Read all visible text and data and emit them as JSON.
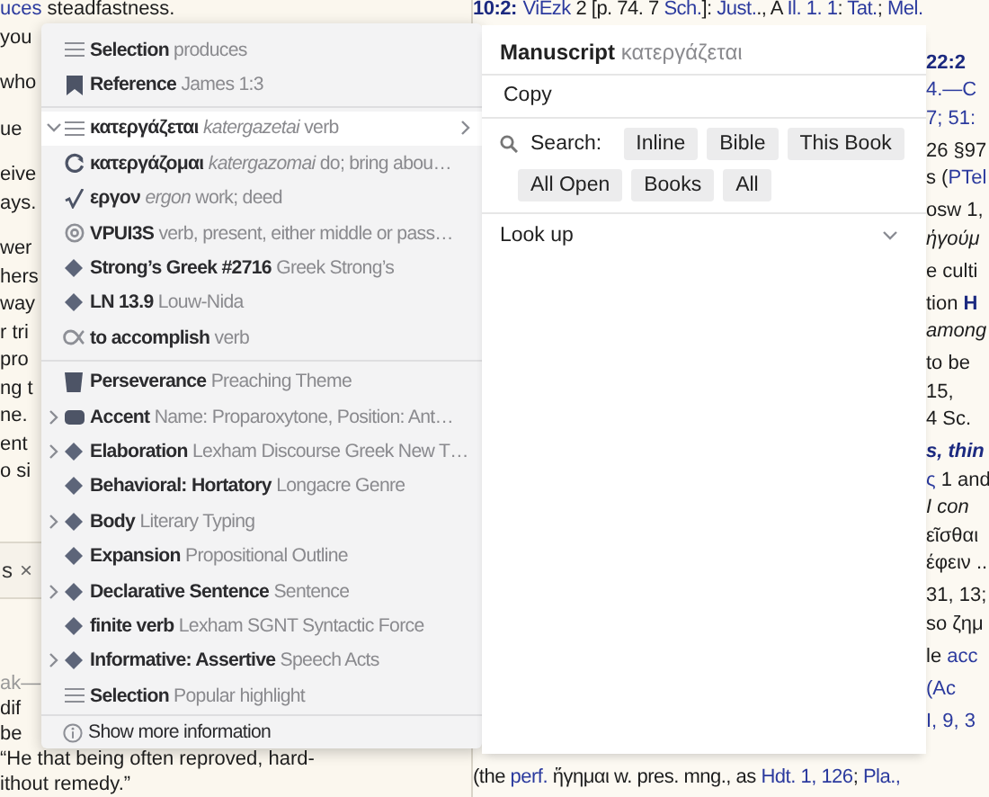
{
  "left_pane": {
    "paragraphs": [
      {
        "lines": [
          [
            {
              "text": "uces",
              "kind": "link"
            },
            {
              "text": " steadfastness."
            }
          ],
          [
            {
              "text": "you"
            }
          ]
        ]
      },
      {
        "lines": [
          [
            {
              "text": "who"
            }
          ]
        ]
      },
      {
        "lines": [
          [
            {
              "text": "ue"
            }
          ]
        ]
      },
      {
        "lines": [
          [
            {
              "text": "eive"
            }
          ],
          [
            {
              "text": "ays."
            }
          ]
        ]
      },
      {
        "lines": [
          [
            {
              "text": "wer"
            }
          ],
          [
            {
              "text": "hers"
            }
          ],
          [
            {
              "text": "way"
            }
          ],
          [
            {
              "text": "r tri"
            }
          ],
          [
            {
              "text": "pro"
            }
          ],
          [
            {
              "text": "ng t"
            }
          ],
          [
            {
              "text": "ne."
            }
          ],
          [
            {
              "text": "ent"
            }
          ],
          [
            {
              "text": "o si"
            }
          ]
        ]
      }
    ],
    "tab": {
      "label": "s",
      "close": "×"
    },
    "second_doc": {
      "header": "ak—",
      "lines": [
        [
          {
            "text": "dif"
          }
        ],
        [
          {
            "text": "be"
          }
        ],
        [
          {
            "text": "“He that being often reproved, hard-"
          }
        ],
        [
          {
            "text": "ithout remedy.”"
          }
        ]
      ]
    }
  },
  "right_pane": {
    "top_line": [
      {
        "text": "10:2:",
        "kind": "bold"
      },
      {
        "text": "ViEzk",
        "kind": "link"
      },
      {
        "text": " 2 [p. 74. 7 "
      },
      {
        "text": "Sch.",
        "kind": "link"
      },
      {
        "text": "]: "
      },
      {
        "text": "Just.",
        "kind": "link"
      },
      {
        "text": "., A "
      },
      {
        "text": "Il. 1. 1",
        "kind": "link"
      },
      {
        "text": ": "
      },
      {
        "text": "Tat.",
        "kind": "link"
      },
      {
        "text": "; "
      },
      {
        "text": "Mel.",
        "kind": "link"
      }
    ],
    "paragraphs": [
      {
        "lines": [
          [
            {
              "text": "22:2",
              "kind": "bold"
            }
          ],
          [
            {
              "text": "4.—C",
              "kind": "link"
            }
          ],
          [
            {
              "text": "7; 51:",
              "kind": "link"
            }
          ]
        ]
      },
      {
        "lines": [
          [
            {
              "text": "26 §97"
            }
          ],
          [
            {
              "text": "s ("
            },
            {
              "text": "PTel",
              "kind": "link"
            }
          ]
        ]
      },
      {
        "lines": [
          [
            {
              "text": "osw 1,"
            }
          ],
          [
            {
              "text": "ἡγούμ",
              "kind": "italic"
            }
          ]
        ]
      },
      {
        "lines": [
          [
            {
              "text": "e culti"
            }
          ]
        ]
      },
      {
        "lines": [
          [
            {
              "text": "tion "
            },
            {
              "text": "H",
              "kind": "bold"
            }
          ],
          [
            {
              "text": "among",
              "kind": "italic"
            }
          ]
        ]
      },
      {
        "lines": [
          [
            {
              "text": "to be"
            }
          ],
          [
            {
              "text": "15,"
            }
          ],
          [
            {
              "text": "4 Sc."
            }
          ]
        ]
      },
      {
        "lines": [
          [
            {
              "text": "s, thin",
              "kind": "bold-italic"
            }
          ],
          [
            {
              "text": "ς",
              "kind": "link"
            },
            {
              "text": " 1 and"
            }
          ],
          [
            {
              "text": "I con",
              "kind": "italic"
            }
          ],
          [
            {
              "text": "εῖσθαι"
            }
          ],
          [
            {
              "text": "έφειν .."
            }
          ]
        ]
      },
      {
        "lines": [
          [
            {
              "text": "31, 13;"
            }
          ],
          [
            {
              "text": "so ζημ"
            }
          ]
        ]
      },
      {
        "lines": [
          [
            {
              "text": "le "
            },
            {
              "text": "acc",
              "kind": "link"
            }
          ]
        ]
      },
      {
        "lines": [
          [
            {
              "text": "(Ac",
              "kind": "link"
            }
          ]
        ]
      },
      {
        "lines": [
          [
            {
              "text": "I, 9, 3",
              "kind": "link"
            }
          ]
        ]
      }
    ],
    "bottom_line": [
      {
        "text": "(the "
      },
      {
        "text": "perf.",
        "kind": "link"
      },
      {
        "text": " ἥγημαι w. pres. mng., as "
      },
      {
        "text": "Hdt. 1, 126",
        "kind": "link"
      },
      {
        "text": "; "
      },
      {
        "text": "Pla.,",
        "kind": "link"
      }
    ]
  },
  "context_menu": {
    "sections": [
      {
        "items": [
          {
            "kind": "lines",
            "label": "Selection",
            "detail": "produces",
            "selected": false
          },
          {
            "kind": "bookmark",
            "label": "Reference",
            "detail": "James 1:3",
            "selected": false
          }
        ]
      },
      {
        "items": [
          {
            "kind": "lines",
            "label": "κατεργάζεται",
            "translit": "katergazetai",
            "detail": "verb",
            "expanded": true,
            "submenu": true,
            "selected": true
          },
          {
            "kind": "cycle",
            "label": "κατεργάζομαι",
            "translit": "katergazomai",
            "detail": "do; bring abou…",
            "selected": false
          },
          {
            "kind": "root",
            "label": "εργον",
            "translit": "ergon",
            "detail": "work; deed",
            "selected": false
          },
          {
            "kind": "at",
            "label": "VPUI3S",
            "detail": "verb, present, either middle or pass…",
            "selected": false
          },
          {
            "kind": "diamond",
            "label": "Strong’s Greek #2716",
            "detail": "Greek Strong’s",
            "selected": false
          },
          {
            "kind": "diamond",
            "label": "LN 13.9",
            "detail": "Louw-Nida",
            "selected": false
          },
          {
            "kind": "loop",
            "label": "to accomplish",
            "detail": "verb",
            "selected": false
          }
        ]
      },
      {
        "items": [
          {
            "kind": "bucket",
            "label": "Perseverance",
            "detail": "Preaching Theme",
            "selected": false
          },
          {
            "kind": "tag",
            "label": "Accent",
            "detail": "Name: Proparoxytone, Position: Ant…",
            "expanded": false,
            "selected": false
          },
          {
            "kind": "diamond",
            "label": "Elaboration",
            "detail": "Lexham Discourse Greek New T…",
            "expanded": false,
            "selected": false
          },
          {
            "kind": "diamond",
            "label": "Behavioral: Hortatory",
            "detail": "Longacre Genre",
            "selected": false
          },
          {
            "kind": "diamond",
            "label": "Body",
            "detail": "Literary Typing",
            "expanded": false,
            "selected": false
          },
          {
            "kind": "diamond",
            "label": "Expansion",
            "detail": "Propositional Outline",
            "selected": false
          },
          {
            "kind": "diamond",
            "label": "Declarative Sentence",
            "detail": "Sentence",
            "expanded": false,
            "selected": false
          },
          {
            "kind": "diamond",
            "label": "finite verb",
            "detail": "Lexham SGNT Syntactic Force",
            "selected": false
          },
          {
            "kind": "diamond",
            "label": "Informative: Assertive",
            "detail": "Speech Acts",
            "expanded": false,
            "selected": false
          },
          {
            "kind": "lines",
            "label": "Selection",
            "detail": "Popular highlight",
            "selected": false
          }
        ]
      }
    ],
    "footer": {
      "kind": "info",
      "label": "Show more information"
    }
  },
  "action_panel": {
    "title": "Manuscript",
    "subtitle": "κατεργάζεται",
    "copy": "Copy",
    "search": {
      "label": "Search:",
      "scopes": [
        "Inline",
        "Bible",
        "This Book",
        "All Open",
        "Books",
        "All"
      ]
    },
    "look_up": {
      "label": "Look up",
      "expanded": false
    }
  }
}
